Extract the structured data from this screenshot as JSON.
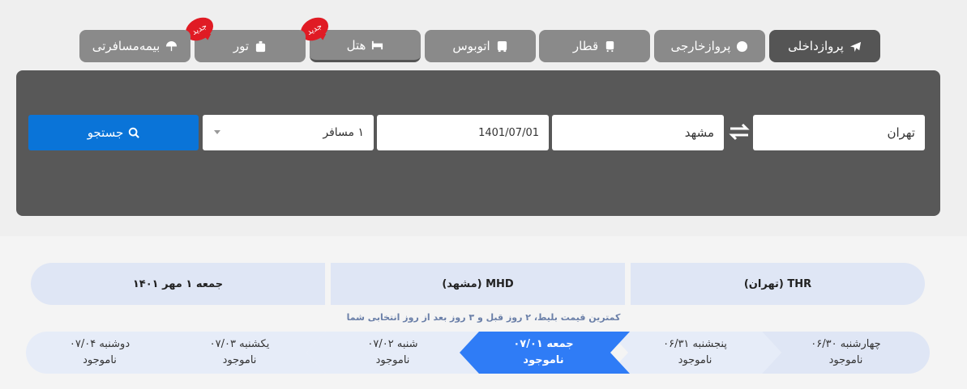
{
  "tabs": [
    {
      "label": "پروازداخلی",
      "icon": "airplane-icon",
      "active": true
    },
    {
      "label": "پروازخارجی",
      "icon": "globe-icon"
    },
    {
      "label": "قطار",
      "icon": "train-icon"
    },
    {
      "label": "اتوبوس",
      "icon": "bus-icon"
    },
    {
      "label": "هتل",
      "icon": "bed-icon",
      "badge": "جدید"
    },
    {
      "label": "تور",
      "icon": "suitcase-icon",
      "badge": "جدید"
    },
    {
      "label": "بیمه‌مسافرتی",
      "icon": "umbrella-icon"
    }
  ],
  "search": {
    "origin": "تهران",
    "destination": "مشهد",
    "date": "1401/07/01",
    "passengers": "۱ مسافر",
    "button_label": "جستجو"
  },
  "route": {
    "origin": "THR (تهران)",
    "destination": "MHD (مشهد)",
    "date": "جمعه ۱ مهر ۱۴۰۱"
  },
  "note": "کمترین قیمت بلیط، ۲ روز قبل و ۳ روز بعد از روز انتخابی شما",
  "days": [
    {
      "label": "چهارشنبه ۰۶/۳۰",
      "status": "ناموجود"
    },
    {
      "label": "پنجشنبه ۰۶/۳۱",
      "status": "ناموجود"
    },
    {
      "label": "جمعه ۰۷/۰۱",
      "status": "ناموجود",
      "active": true
    },
    {
      "label": "شنبه ۰۷/۰۲",
      "status": "ناموجود"
    },
    {
      "label": "یکشنبه ۰۷/۰۳",
      "status": "ناموجود"
    },
    {
      "label": "دوشنبه ۰۷/۰۴",
      "status": "ناموجود"
    }
  ],
  "colors": {
    "panel": "#585858",
    "accent": "#0a74d8",
    "active_day": "#2f7cf6",
    "day_bg": "#dfe6f5",
    "badge": "#e01b24"
  }
}
